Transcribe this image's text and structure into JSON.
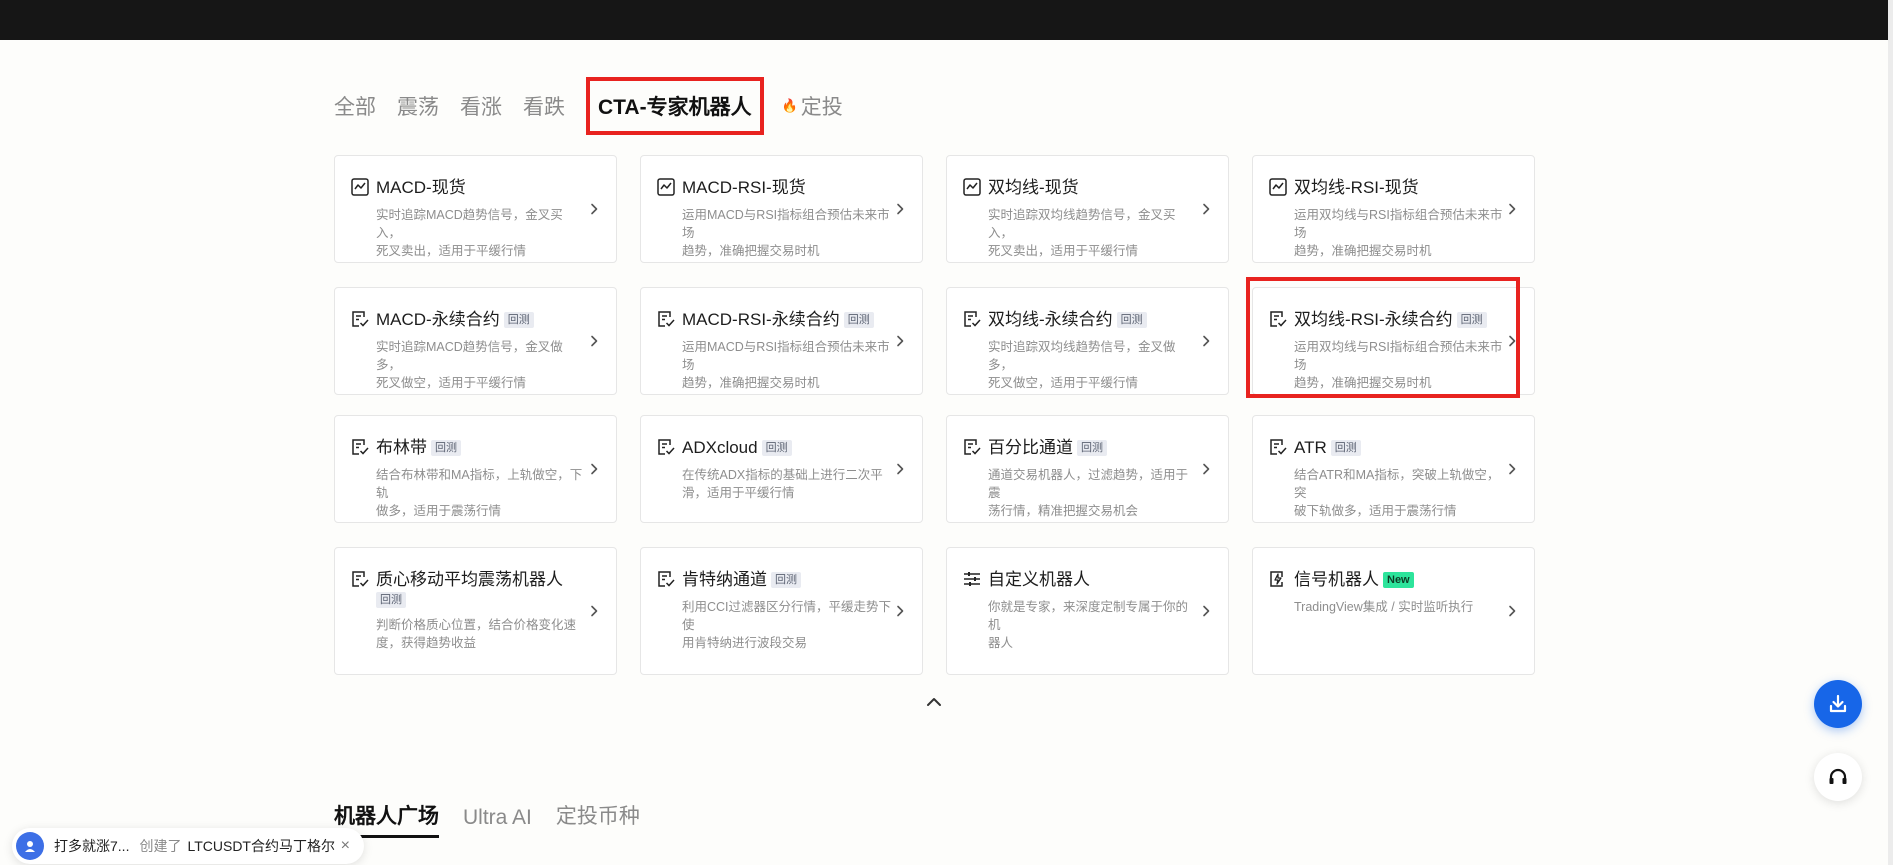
{
  "filter_tabs": [
    {
      "label": "全部"
    },
    {
      "label": "震荡"
    },
    {
      "label": "看涨"
    },
    {
      "label": "看跌"
    },
    {
      "label": "CTA-专家机器人",
      "active": true
    },
    {
      "label": "定投",
      "icon": "flame-icon"
    }
  ],
  "cards": [
    {
      "title": "MACD-现货",
      "icon": "line-chart-icon",
      "desc": [
        "实时追踪MACD趋势信号，金叉买入，",
        "死叉卖出，适用于平缓行情"
      ]
    },
    {
      "title": "MACD-RSI-现货",
      "icon": "line-chart-icon",
      "desc": [
        "运用MACD与RSI指标组合预估未来市场",
        "趋势，准确把握交易时机"
      ]
    },
    {
      "title": "双均线-现货",
      "icon": "line-chart-icon",
      "desc": [
        "实时追踪双均线趋势信号，金叉买入，",
        "死叉卖出，适用于平缓行情"
      ]
    },
    {
      "title": "双均线-RSI-现货",
      "icon": "line-chart-icon",
      "desc": [
        "运用双均线与RSI指标组合预估未来市场",
        "趋势，准确把握交易时机"
      ]
    },
    {
      "title": "MACD-永续合约",
      "icon": "contract-icon",
      "badge": "回测",
      "desc": [
        "实时追踪MACD趋势信号，金叉做多，",
        "死叉做空，适用于平缓行情"
      ]
    },
    {
      "title": "MACD-RSI-永续合约",
      "icon": "contract-icon",
      "badge": "回测",
      "desc": [
        "运用MACD与RSI指标组合预估未来市场",
        "趋势，准确把握交易时机"
      ]
    },
    {
      "title": "双均线-永续合约",
      "icon": "contract-icon",
      "badge": "回测",
      "desc": [
        "实时追踪双均线趋势信号，金叉做多，",
        "死叉做空，适用于平缓行情"
      ]
    },
    {
      "title": "双均线-RSI-永续合约",
      "icon": "contract-icon",
      "badge": "回测",
      "desc": [
        "运用双均线与RSI指标组合预估未来市场",
        "趋势，准确把握交易时机"
      ]
    },
    {
      "title": "布林带",
      "icon": "contract-icon",
      "badge": "回测",
      "desc": [
        "结合布林带和MA指标，上轨做空，下轨",
        "做多，适用于震荡行情"
      ]
    },
    {
      "title": "ADXcloud",
      "icon": "contract-icon",
      "badge": "回测",
      "desc": [
        "在传统ADX指标的基础上进行二次平",
        "滑，适用于平缓行情"
      ]
    },
    {
      "title": "百分比通道",
      "icon": "contract-icon",
      "badge": "回测",
      "desc": [
        "通道交易机器人，过滤趋势，适用于震",
        "荡行情，精准把握交易机会"
      ]
    },
    {
      "title": "ATR",
      "icon": "contract-icon",
      "badge": "回测",
      "desc": [
        "结合ATR和MA指标，突破上轨做空，突",
        "破下轨做多，适用于震荡行情"
      ]
    },
    {
      "title": "质心移动平均震荡机器人",
      "icon": "contract-icon",
      "badge": "回测",
      "badge_newline": true,
      "desc": [
        "判断价格质心位置，结合价格变化速",
        "度，获得趋势收益"
      ]
    },
    {
      "title": "肯特纳通道",
      "icon": "contract-icon",
      "badge": "回测",
      "desc": [
        "利用CCI过滤器区分行情，平缓走势下使",
        "用肯特纳进行波段交易"
      ]
    },
    {
      "title": "自定义机器人",
      "icon": "sliders-icon",
      "desc": [
        "你就是专家，来深度定制专属于你的机",
        "器人"
      ]
    },
    {
      "title": "信号机器人",
      "icon": "signal-icon",
      "badge": "New",
      "badge_style": "new",
      "desc": [
        "TradingView集成 / 实时监听执行"
      ]
    }
  ],
  "bottom_tabs": [
    {
      "label": "机器人广场",
      "active": true
    },
    {
      "label": "Ultra AI"
    },
    {
      "label": "定投币种"
    }
  ],
  "toast": {
    "user": "打多就涨7...",
    "action": "创建了",
    "target": "LTCUSDT合约马丁格尔",
    "close": "×"
  },
  "colors": {
    "accent": "#1766e8",
    "highlight": "#e8231f",
    "new_badge": "#2de49b"
  }
}
